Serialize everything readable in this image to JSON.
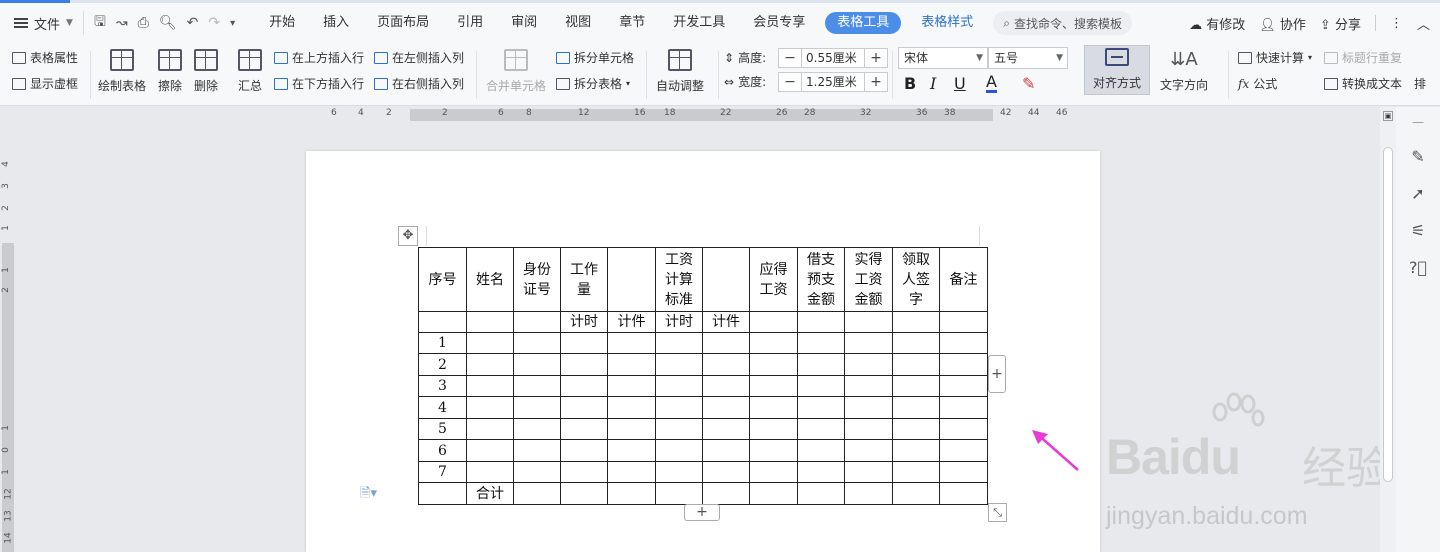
{
  "menubar": {
    "file_label": "文件",
    "tabs": [
      "开始",
      "插入",
      "页面布局",
      "引用",
      "审阅",
      "视图",
      "章节",
      "开发工具",
      "会员专享"
    ],
    "active_tab": "表格工具",
    "table_style_tab": "表格样式",
    "search_placeholder": "查找命令、搜索模板",
    "changes": "有修改",
    "collab": "协作",
    "share": "分享"
  },
  "ribbon": {
    "table_props": "表格属性",
    "show_gridlines": "显示虚框",
    "draw_table": "绘制表格",
    "erase": "擦除",
    "delete": "删除",
    "summary": "汇总",
    "insert_above": "在上方插入行",
    "insert_below": "在下方插入行",
    "insert_left": "在左侧插入列",
    "insert_right": "在右侧插入列",
    "merge_cells": "合并单元格",
    "split_cells": "拆分单元格",
    "split_table": "拆分表格",
    "auto_fit": "自动调整",
    "height_label": "高度:",
    "height_value": "0.55厘米",
    "width_label": "宽度:",
    "width_value": "1.25厘米",
    "font": "宋体",
    "size": "五号",
    "align": "对齐方式",
    "text_dir": "文字方向",
    "quick_calc": "快速计算",
    "formula": "公式",
    "repeat_header": "标题行重复",
    "to_text": "转换成文本",
    "more": "排"
  },
  "ruler": {
    "h_ticks": [
      "6",
      "4",
      "2",
      "2",
      "6",
      "8",
      "12",
      "16",
      "18",
      "22",
      "26",
      "28",
      "32",
      "36",
      "38",
      "42",
      "44",
      "46"
    ],
    "v_ticks": [
      "4",
      "3",
      "2",
      "1",
      "1",
      "2",
      "1",
      "0",
      "1",
      "12",
      "13",
      "14"
    ]
  },
  "table": {
    "header": {
      "seq": "序号",
      "name": "姓名",
      "id": "身份证号",
      "work": "工作量",
      "std": "工资计算标准",
      "due": "应得工资",
      "advance": "借支预支金额",
      "actual": "实得工资金额",
      "sign": "领取人签字",
      "note": "备注"
    },
    "sub": {
      "time1": "计时",
      "piece1": "计件",
      "time2": "计时",
      "piece2": "计件"
    },
    "rows": [
      "1",
      "2",
      "3",
      "4",
      "5",
      "6",
      "7"
    ],
    "total": "合计"
  },
  "watermark": {
    "brand": "Baidu",
    "cn": "经验",
    "url": "jingyan.baidu.com"
  },
  "colors": {
    "accent": "#4c8de8",
    "arrow": "#e83ad6"
  }
}
